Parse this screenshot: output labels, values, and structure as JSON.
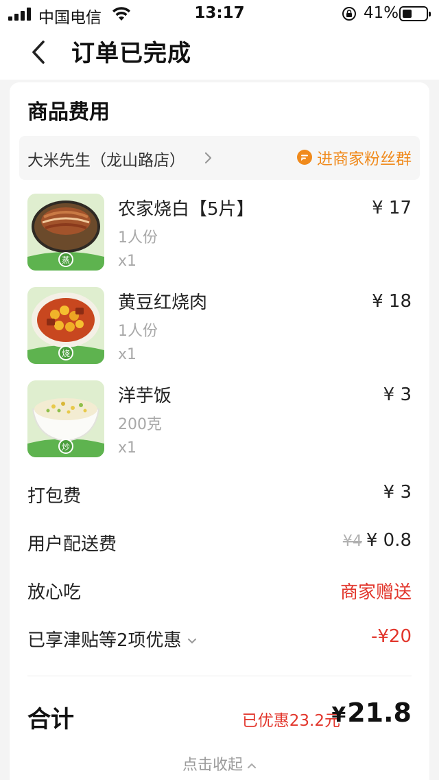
{
  "status_bar": {
    "carrier": "中国电信",
    "time": "13:17",
    "battery": "41%",
    "battery_level": 0.41,
    "icons": [
      "signal-icon",
      "wifi-icon",
      "rotation-lock-icon",
      "battery-icon"
    ]
  },
  "nav": {
    "back_icon": "chevron-left-icon",
    "title": "订单已完成"
  },
  "section": {
    "title": "商品费用"
  },
  "shop": {
    "name": "大米先生（龙山路店）",
    "fans_group": "进商家粉丝群",
    "accent": "#f08a1c"
  },
  "items": [
    {
      "name": "农家烧白【5片】",
      "spec": "1人份",
      "qty": "x1",
      "price": "¥ 17",
      "badge": "蒸",
      "image": "braised-pork-dish"
    },
    {
      "name": "黄豆红烧肉",
      "spec": "1人份",
      "qty": "x1",
      "price": "¥ 18",
      "badge": "烧",
      "image": "soybean-braised-pork-dish"
    },
    {
      "name": "洋芋饭",
      "spec": "200克",
      "qty": "x1",
      "price": "¥ 3",
      "badge": "炒",
      "image": "potato-rice-bowl"
    }
  ],
  "fees": {
    "packaging": {
      "label": "打包费",
      "value": "¥ 3"
    },
    "delivery": {
      "label": "用户配送费",
      "original": "¥4",
      "value": "¥ 0.8"
    },
    "safe_eat": {
      "label": "放心吃",
      "value": "商家赠送"
    },
    "discount": {
      "label": "已享津贴等2项优惠",
      "value": "-¥20"
    }
  },
  "total": {
    "label": "合计",
    "saved": "已优惠23.2元",
    "currency": "¥",
    "amount": "21.8"
  },
  "collapse_label": "点击收起",
  "colors": {
    "red": "#e2362c",
    "orange": "#f08a1c",
    "green_badge": "#4fae4a"
  }
}
